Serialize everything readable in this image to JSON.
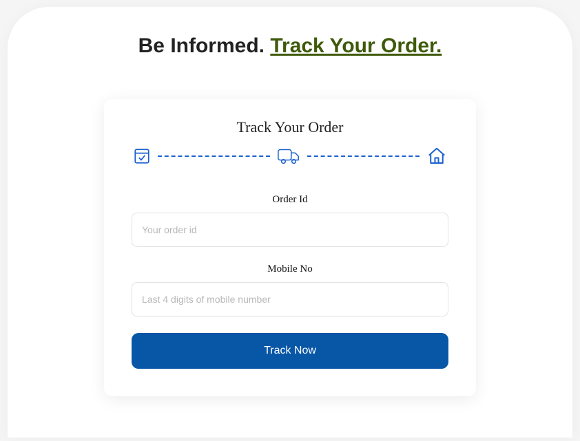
{
  "heading": {
    "prefix": "Be Informed. ",
    "accent": "Track Your Order."
  },
  "card": {
    "title": "Track Your Order",
    "fields": {
      "order_id": {
        "label": "Order Id",
        "placeholder": "Your order id",
        "value": ""
      },
      "mobile_no": {
        "label": "Mobile No",
        "placeholder": "Last 4 digits of mobile number",
        "value": ""
      }
    },
    "button_label": "Track Now"
  },
  "colors": {
    "accent_blue": "#1a61cf",
    "button_blue": "#0856a6",
    "heading_green": "#3f5a0a"
  }
}
